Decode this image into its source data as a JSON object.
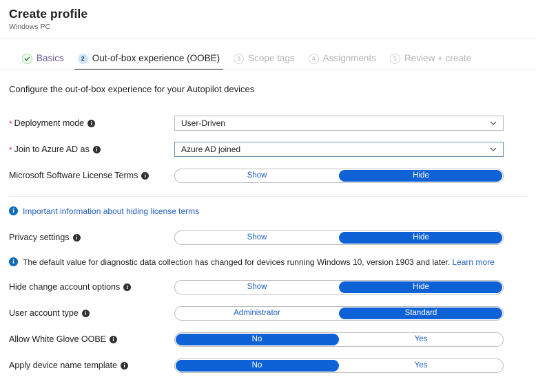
{
  "header": {
    "title": "Create profile",
    "subtitle": "Windows PC"
  },
  "tabs": [
    {
      "step": "1",
      "label": "Basics",
      "state": "done",
      "icon": "check-icon"
    },
    {
      "step": "2",
      "label": "Out-of-box experience (OOBE)",
      "state": "current"
    },
    {
      "step": "3",
      "label": "Scope tags",
      "state": "upcoming"
    },
    {
      "step": "4",
      "label": "Assignments",
      "state": "upcoming"
    },
    {
      "step": "5",
      "label": "Review + create",
      "state": "upcoming"
    }
  ],
  "main": {
    "intro": "Configure the out-of-box experience for your Autopilot devices",
    "deployment_mode": {
      "label": "Deployment mode",
      "required_marker": "*",
      "value": "User-Driven"
    },
    "join_azure_ad": {
      "label": "Join to Azure AD as",
      "required_marker": "*",
      "value": "Azure AD joined"
    },
    "license_terms": {
      "label": "Microsoft Software License Terms",
      "option_left": "Show",
      "option_right": "Hide",
      "selected": "right"
    },
    "license_info": {
      "icon": "info-icon",
      "link_text": "Important information about hiding license terms"
    },
    "privacy_settings": {
      "label": "Privacy settings",
      "option_left": "Show",
      "option_right": "Hide",
      "selected": "right"
    },
    "privacy_info": {
      "icon": "info-icon",
      "text": "The default value for diagnostic data collection has changed for devices running Windows 10, version 1903 and later.",
      "link_text": "Learn more"
    },
    "hide_change_account": {
      "label": "Hide change account options",
      "option_left": "Show",
      "option_right": "Hide",
      "selected": "right"
    },
    "user_account_type": {
      "label": "User account type",
      "option_left": "Administrator",
      "option_right": "Standard",
      "selected": "right"
    },
    "white_glove": {
      "label": "Allow White Glove OOBE",
      "option_left": "No",
      "option_right": "Yes",
      "selected": "left"
    },
    "device_name_template": {
      "label": "Apply device name template",
      "option_left": "No",
      "option_right": "Yes",
      "selected": "left"
    }
  },
  "colors": {
    "accent_blue": "#0f62d6",
    "link_blue": "#1f5fbf",
    "required_red": "#d13438",
    "success_green": "#107c10"
  }
}
